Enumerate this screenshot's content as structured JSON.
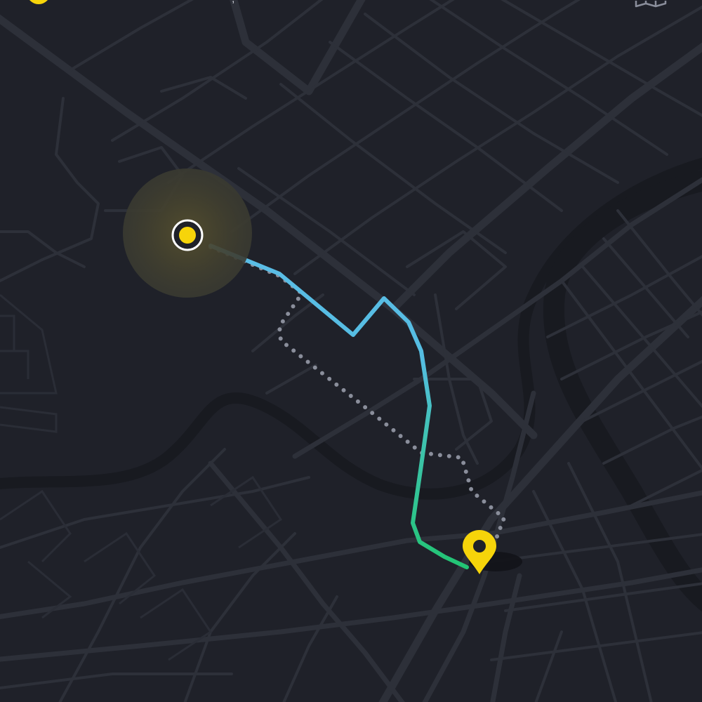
{
  "top_bar": {
    "status_text": ",",
    "map_toggle_icon": "folded-map-icon",
    "badge_icon": "yellow-circle-icon"
  },
  "map": {
    "theme": "dark",
    "colors": {
      "background": "#1f2129",
      "road": "#2d3039",
      "river": "#181a20",
      "accent": "#f6d40a",
      "route_start": "#5bbde6",
      "route_end": "#22c473",
      "alternate_route": "#8a8e9b"
    },
    "origin": {
      "icon": "current-location-icon",
      "label": ""
    },
    "destination": {
      "icon": "map-pin-icon",
      "label": ""
    },
    "primary_route": {
      "style": "solid-gradient"
    },
    "alternate_route": {
      "style": "dotted"
    }
  }
}
